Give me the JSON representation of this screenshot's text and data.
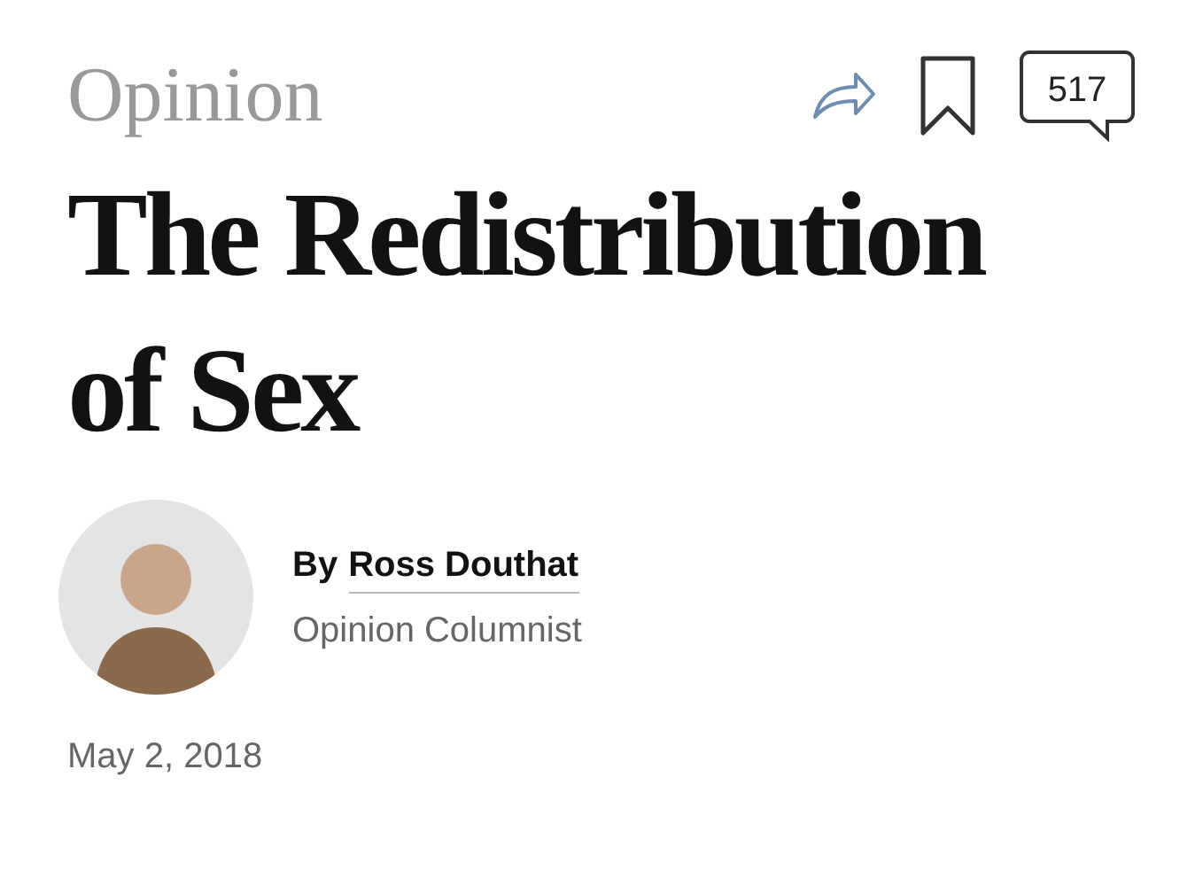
{
  "section": "Opinion",
  "toolbar": {
    "comment_count": "517"
  },
  "headline_lines": [
    "The Redistribution",
    "of Sex"
  ],
  "byline": {
    "prefix": "By",
    "author": "Ross Douthat",
    "role": "Opinion Columnist"
  },
  "date": "May 2, 2018"
}
